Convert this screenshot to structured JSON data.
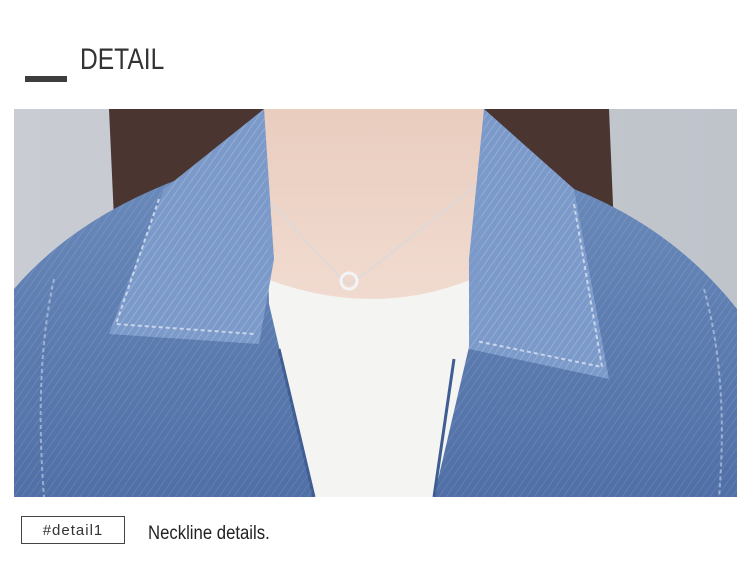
{
  "header": {
    "title": "DETAIL"
  },
  "photo": {
    "subject": "denim jacket collar over white t-shirt with pendant necklace"
  },
  "tag": {
    "label": "#detail1"
  },
  "caption": {
    "text": "Neckline details."
  }
}
